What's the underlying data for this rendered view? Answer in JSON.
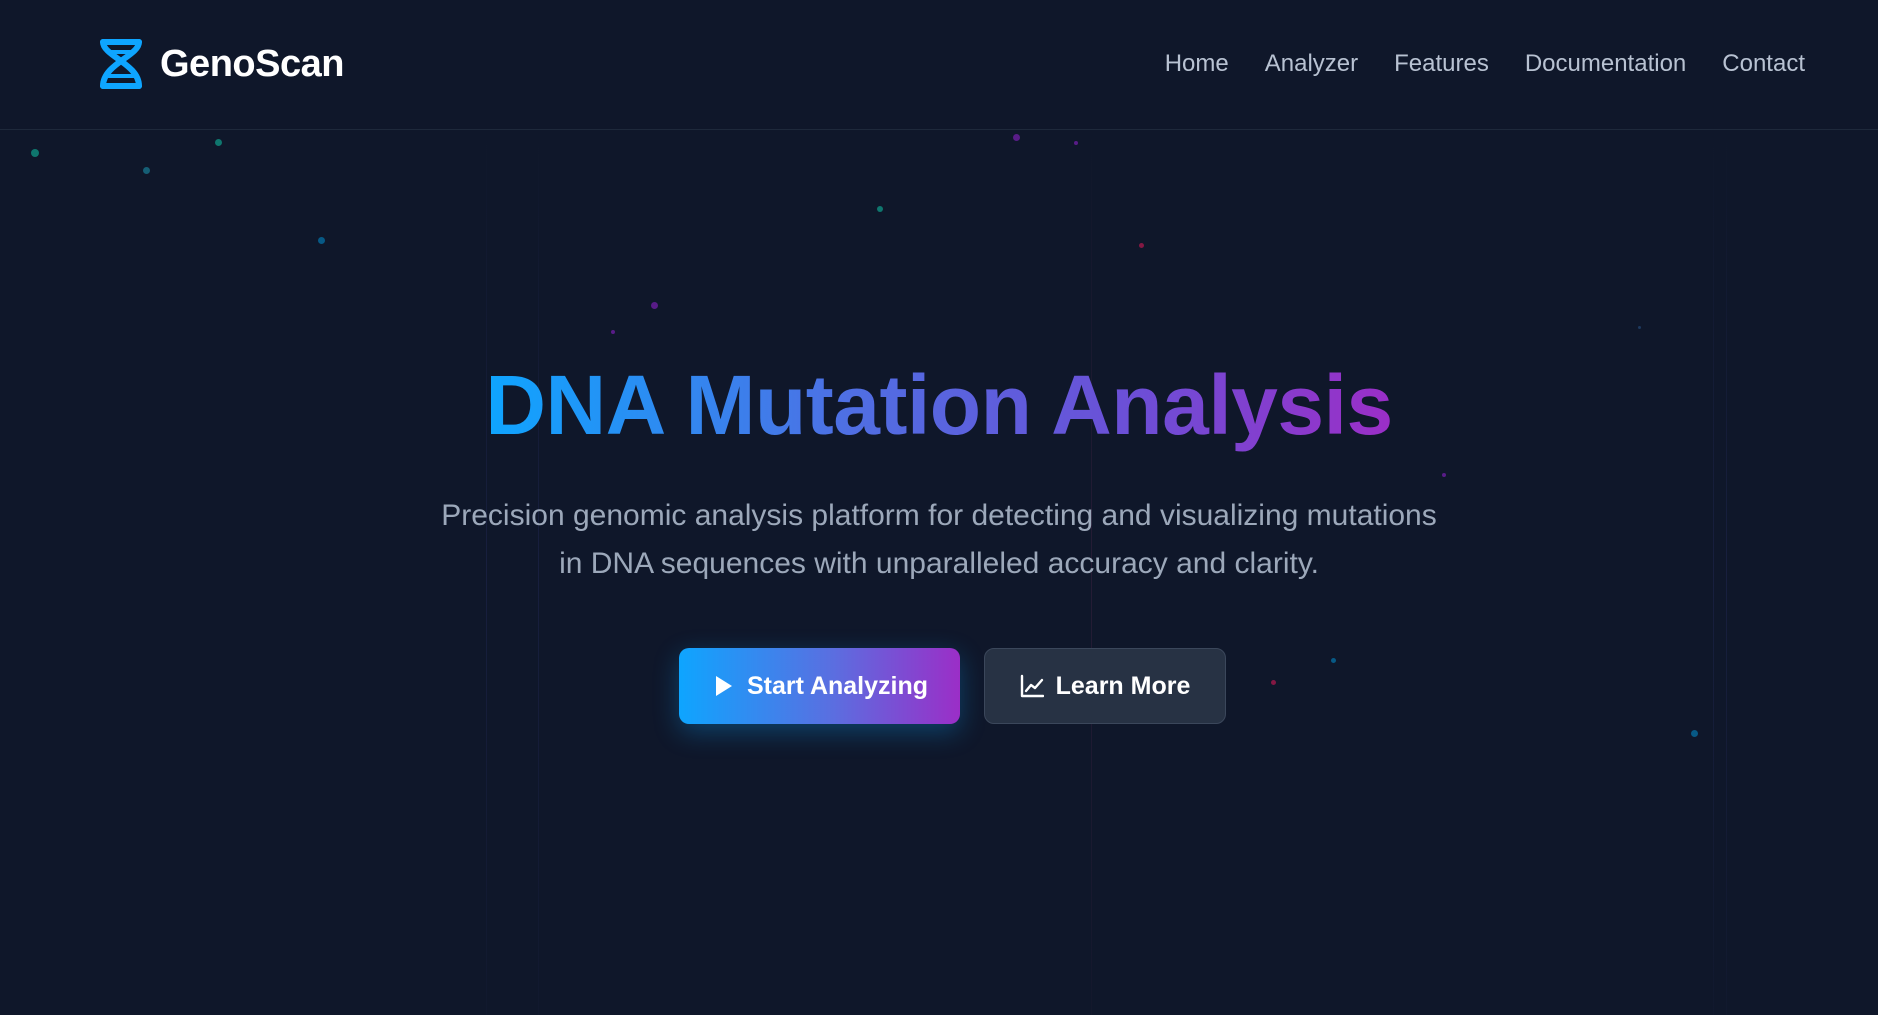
{
  "brand": {
    "name": "GenoScan",
    "icon": "dna-icon"
  },
  "nav": {
    "items": [
      "Home",
      "Analyzer",
      "Features",
      "Documentation",
      "Contact"
    ]
  },
  "hero": {
    "title": "DNA Mutation Analysis",
    "subtitle": "Precision genomic analysis platform for detecting and visualizing mutations in DNA sequences with unparalleled accuracy and clarity.",
    "primary_button": {
      "label": "Start Analyzing",
      "icon": "play-icon"
    },
    "secondary_button": {
      "label": "Learn More",
      "icon": "chart-line-icon"
    }
  },
  "colors": {
    "background": "#0f172a",
    "accent_start": "#0ea5ff",
    "accent_end": "#9b2ec7",
    "nav_text": "#b8c2d2",
    "secondary_button_bg": "#273244"
  }
}
